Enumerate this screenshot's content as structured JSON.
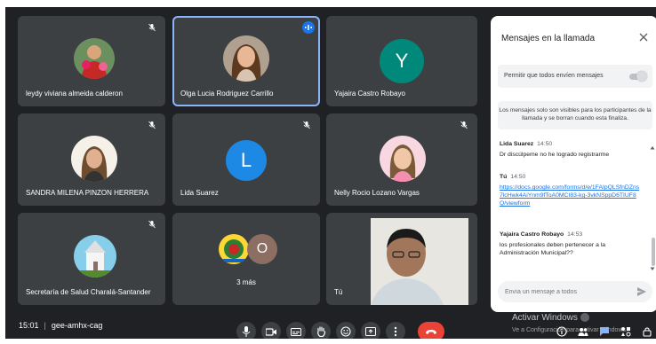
{
  "participants": [
    {
      "name": "leydy viviana almeida calderon",
      "muted": true
    },
    {
      "name": "Olga Lucia Rodriguez Carrillo",
      "speaking": true
    },
    {
      "name": "Yajaira Castro Robayo",
      "initial": "Y",
      "muted": true
    },
    {
      "name": "SANDRA MILENA PINZON HERRERA",
      "muted": true
    },
    {
      "name": "Lida Suarez",
      "initial": "L",
      "muted": true
    },
    {
      "name": "Nelly Rocio Lozano Vargas",
      "muted": true
    },
    {
      "name": "Secretaría de Salud Charalá-Santander",
      "muted": true
    },
    {
      "name": "3 más",
      "extra_initial": "O"
    },
    {
      "name": "Tú"
    }
  ],
  "colors": {
    "background": "#202124",
    "tile": "#3c4043",
    "active_border": "#8ab4f8",
    "avatar_teal": "#00897b",
    "avatar_blue": "#1e88e5",
    "avatar_brown": "#8d6e63",
    "hangup": "#ea4335",
    "link": "#1a73e8"
  },
  "chat": {
    "title": "Mensajes en la llamada",
    "permit_label": "Permitir que todos envíen mensajes",
    "permit_enabled": true,
    "notice": "Los mensajes solo son visibles para los participantes de la llamada y se borran cuando esta finaliza.",
    "messages": [
      {
        "sender": "Lida Suarez",
        "time": "14:50",
        "text": "Dr discúlpeme no he logrado registrarme"
      },
      {
        "sender": "Tú",
        "time": "14:50",
        "link": "https://docs.google.com/forms/d/e/1FAIpQLSfnDZns7lcHwk4AiYnm9fToA0MCI83-kg-3vkNSppD6TIUF8Q/viewform"
      },
      {
        "sender": "Yajaira Castro Robayo",
        "time": "14:53",
        "text": "los profesionales deben pertenecer a la Administración Municipal??"
      }
    ],
    "placeholder": "Envía un mensaje a todos"
  },
  "meeting": {
    "time": "15:01",
    "code": "gee-amhx-cag"
  },
  "controls": [
    "microphone-icon",
    "camera-icon",
    "captions-icon",
    "raise-hand-icon",
    "emoji-icon",
    "present-icon",
    "more-options-icon",
    "hang-up-icon"
  ],
  "watermark": {
    "line1": "Activar Windows",
    "line2": "Ve a Configuración para activar Windows."
  }
}
